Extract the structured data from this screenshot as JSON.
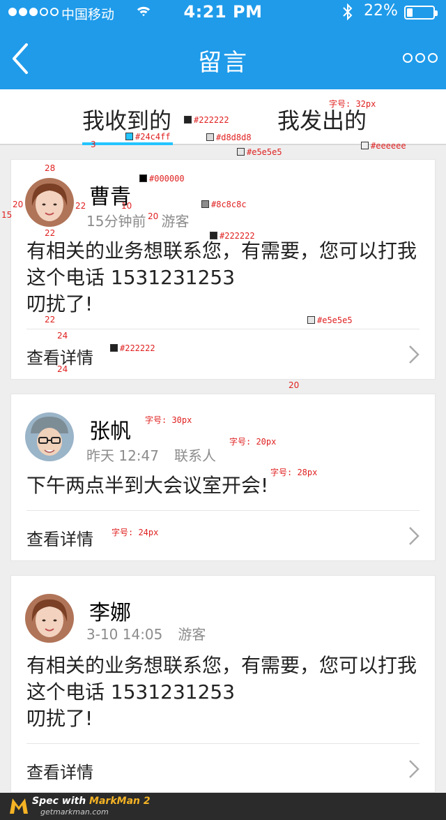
{
  "status_bar": {
    "carrier": "中国移动",
    "time": "4:21 PM",
    "battery": "22%",
    "battery_level": 0.22
  },
  "nav": {
    "title": "留言"
  },
  "tabs": [
    {
      "label": "我收到的",
      "active": true
    },
    {
      "label": "我发出的",
      "active": false
    }
  ],
  "messages": [
    {
      "name": "曹青",
      "time": "15分钟前",
      "role": "游客",
      "body": [
        "有相关的业务想联系您，有需要，您可以打我",
        "这个电话 1531231253",
        "叨扰了!"
      ],
      "detail": "查看详情"
    },
    {
      "name": "张帆",
      "time": "昨天 12:47",
      "role": "联系人",
      "body": [
        "下午两点半到大会议室开会!"
      ],
      "detail": "查看详情"
    },
    {
      "name": "李娜",
      "time": "3-10  14:05",
      "role": "游客",
      "body": [
        "有相关的业务想联系您，有需要，您可以打我",
        "这个电话 1531231253",
        "叨扰了!"
      ],
      "detail": "查看详情"
    }
  ],
  "annotations": {
    "tab_color": "#222222",
    "underline_color": "#24c4ff",
    "border_color": "#d8d8d8",
    "card_border": "#e5e5e5",
    "bg_color": "#eeeeee",
    "name_color": "#000000",
    "meta_color": "#8c8c8c",
    "body_color": "#222222",
    "divider_color": "#e5e5e5",
    "detail_color": "#222222",
    "font_tab": "字号: 32px",
    "font_name": "字号: 30px",
    "font_meta": "字号: 20px",
    "font_body": "字号: 28px",
    "font_detail": "字号: 24px",
    "dims": {
      "d28": "28",
      "d20a": "20",
      "d15": "15",
      "d22a": "22",
      "d10": "10",
      "d20b": "20",
      "d22b": "22",
      "d22c": "22",
      "d24a": "24",
      "d24b": "24",
      "d20c": "20",
      "d3": "3"
    }
  },
  "footer": {
    "brand_prefix": "Spec with ",
    "brand_name": "MarkMan 2",
    "url": "getmarkman.com"
  },
  "colors": {
    "header_bg": "#1f9bea",
    "accent": "#24c4ff"
  }
}
